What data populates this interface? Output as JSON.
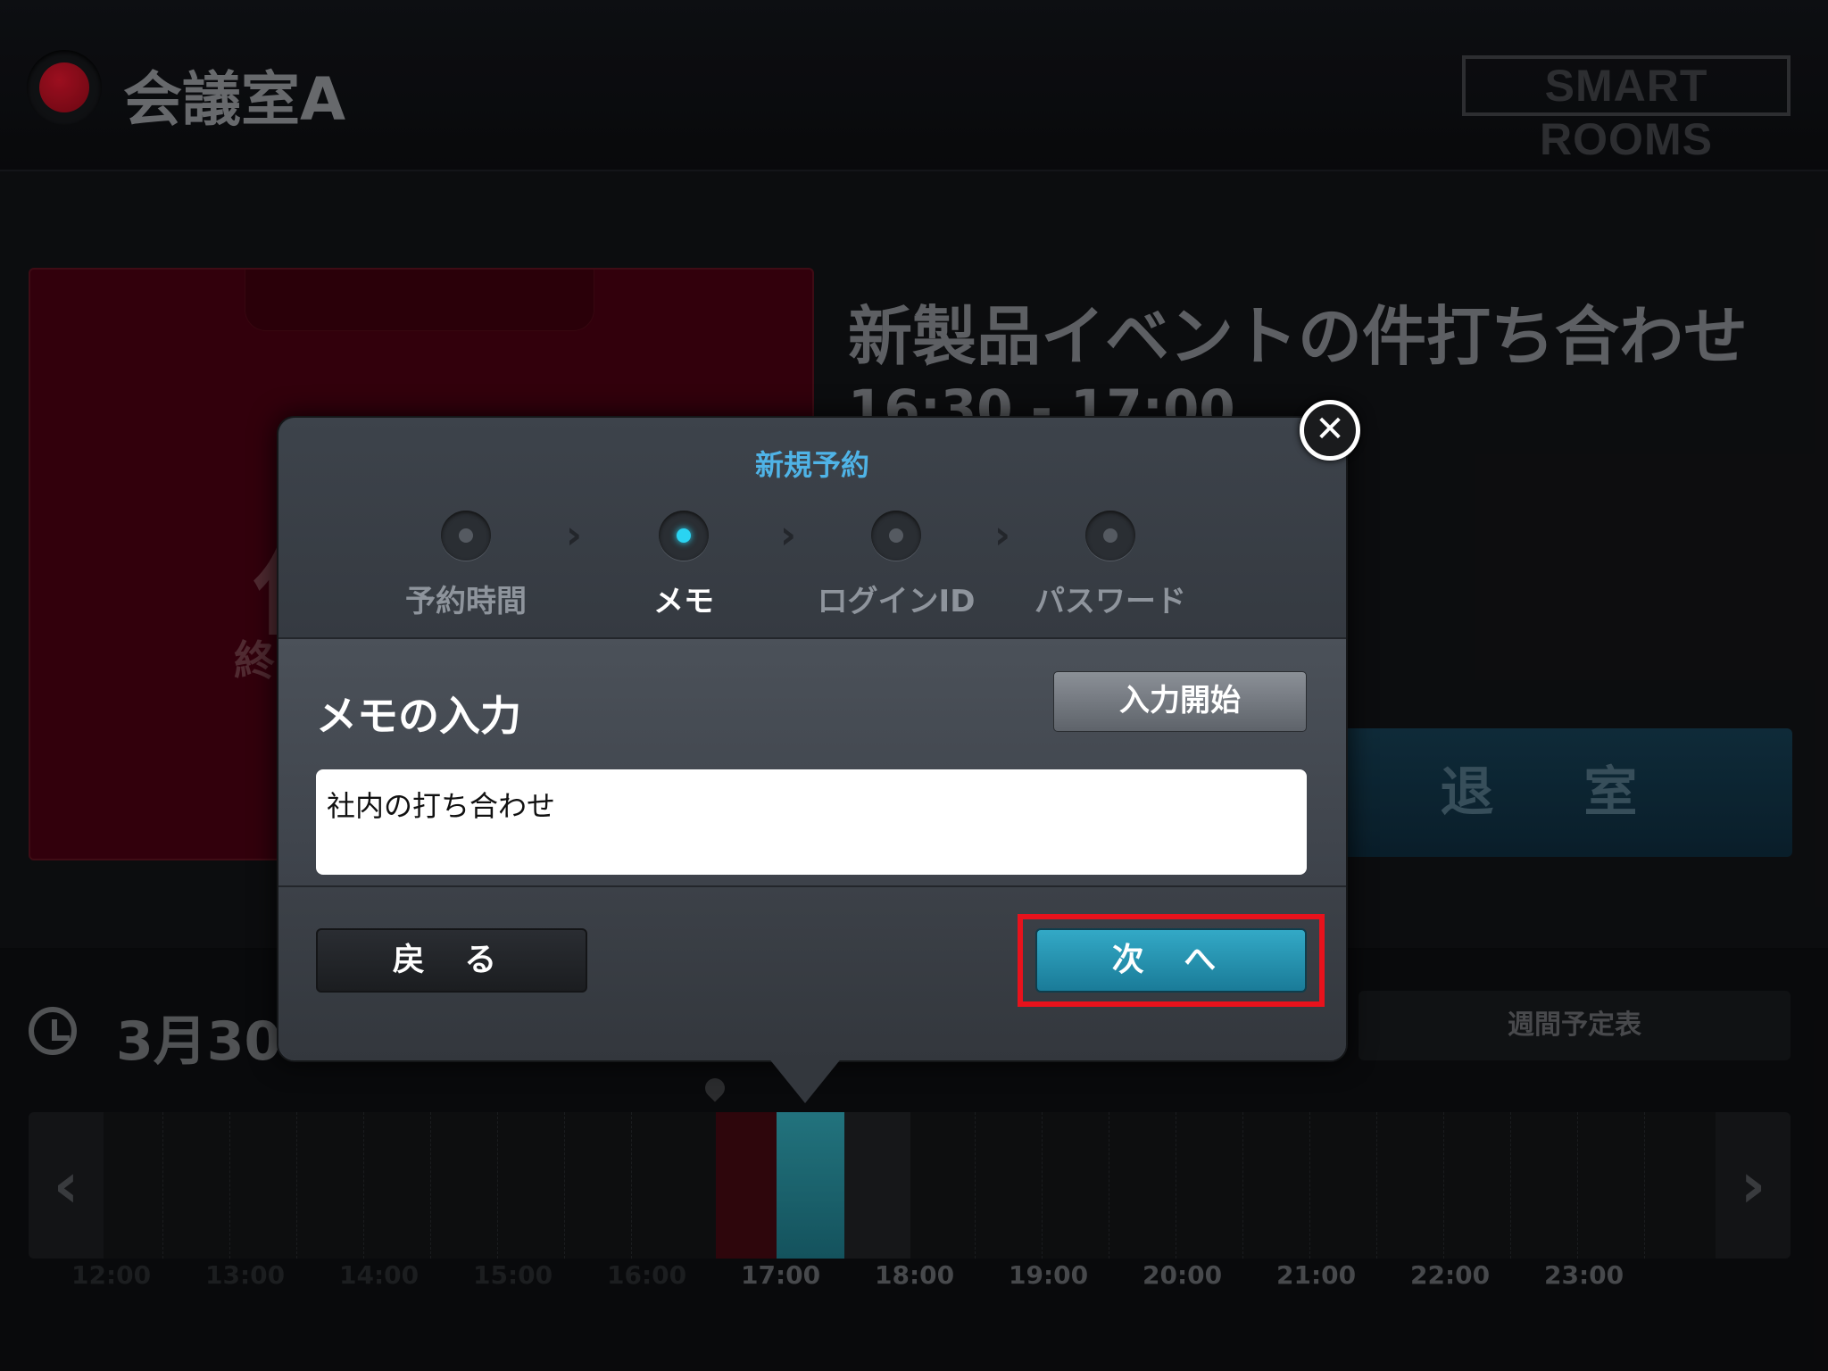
{
  "header": {
    "room_name": "会議室A",
    "logo_text": "SMART ROOMS",
    "status_color": "#c8102e"
  },
  "current": {
    "card_big_char": "使",
    "card_sub_text": "終",
    "event_title": "新製品イベントの件打ち合わせ",
    "event_time": "16:30 - 17:00",
    "checkout_label": "退 室"
  },
  "schedule": {
    "date_text": "3月30",
    "weekly_label": "週間予定表",
    "ticks": [
      "12:00",
      "13:00",
      "14:00",
      "15:00",
      "16:00",
      "17:00",
      "18:00",
      "19:00",
      "20:00",
      "21:00",
      "22:00",
      "23:00"
    ]
  },
  "modal": {
    "title": "新規予約",
    "steps": [
      {
        "label": "予約時間",
        "active": false
      },
      {
        "label": "メモ",
        "active": true
      },
      {
        "label": "ログインID",
        "active": false
      },
      {
        "label": "パスワード",
        "active": false
      }
    ],
    "memo_heading": "メモの入力",
    "start_input_label": "入力開始",
    "memo_value": "社内の打ち合わせ",
    "back_label": "戻 る",
    "next_label": "次 へ",
    "close_symbol": "✕"
  },
  "colors": {
    "accent": "#4fb3e6",
    "active_step": "#2ad4f2",
    "next_button": "#2a95b3",
    "highlight": "#e8121c"
  }
}
